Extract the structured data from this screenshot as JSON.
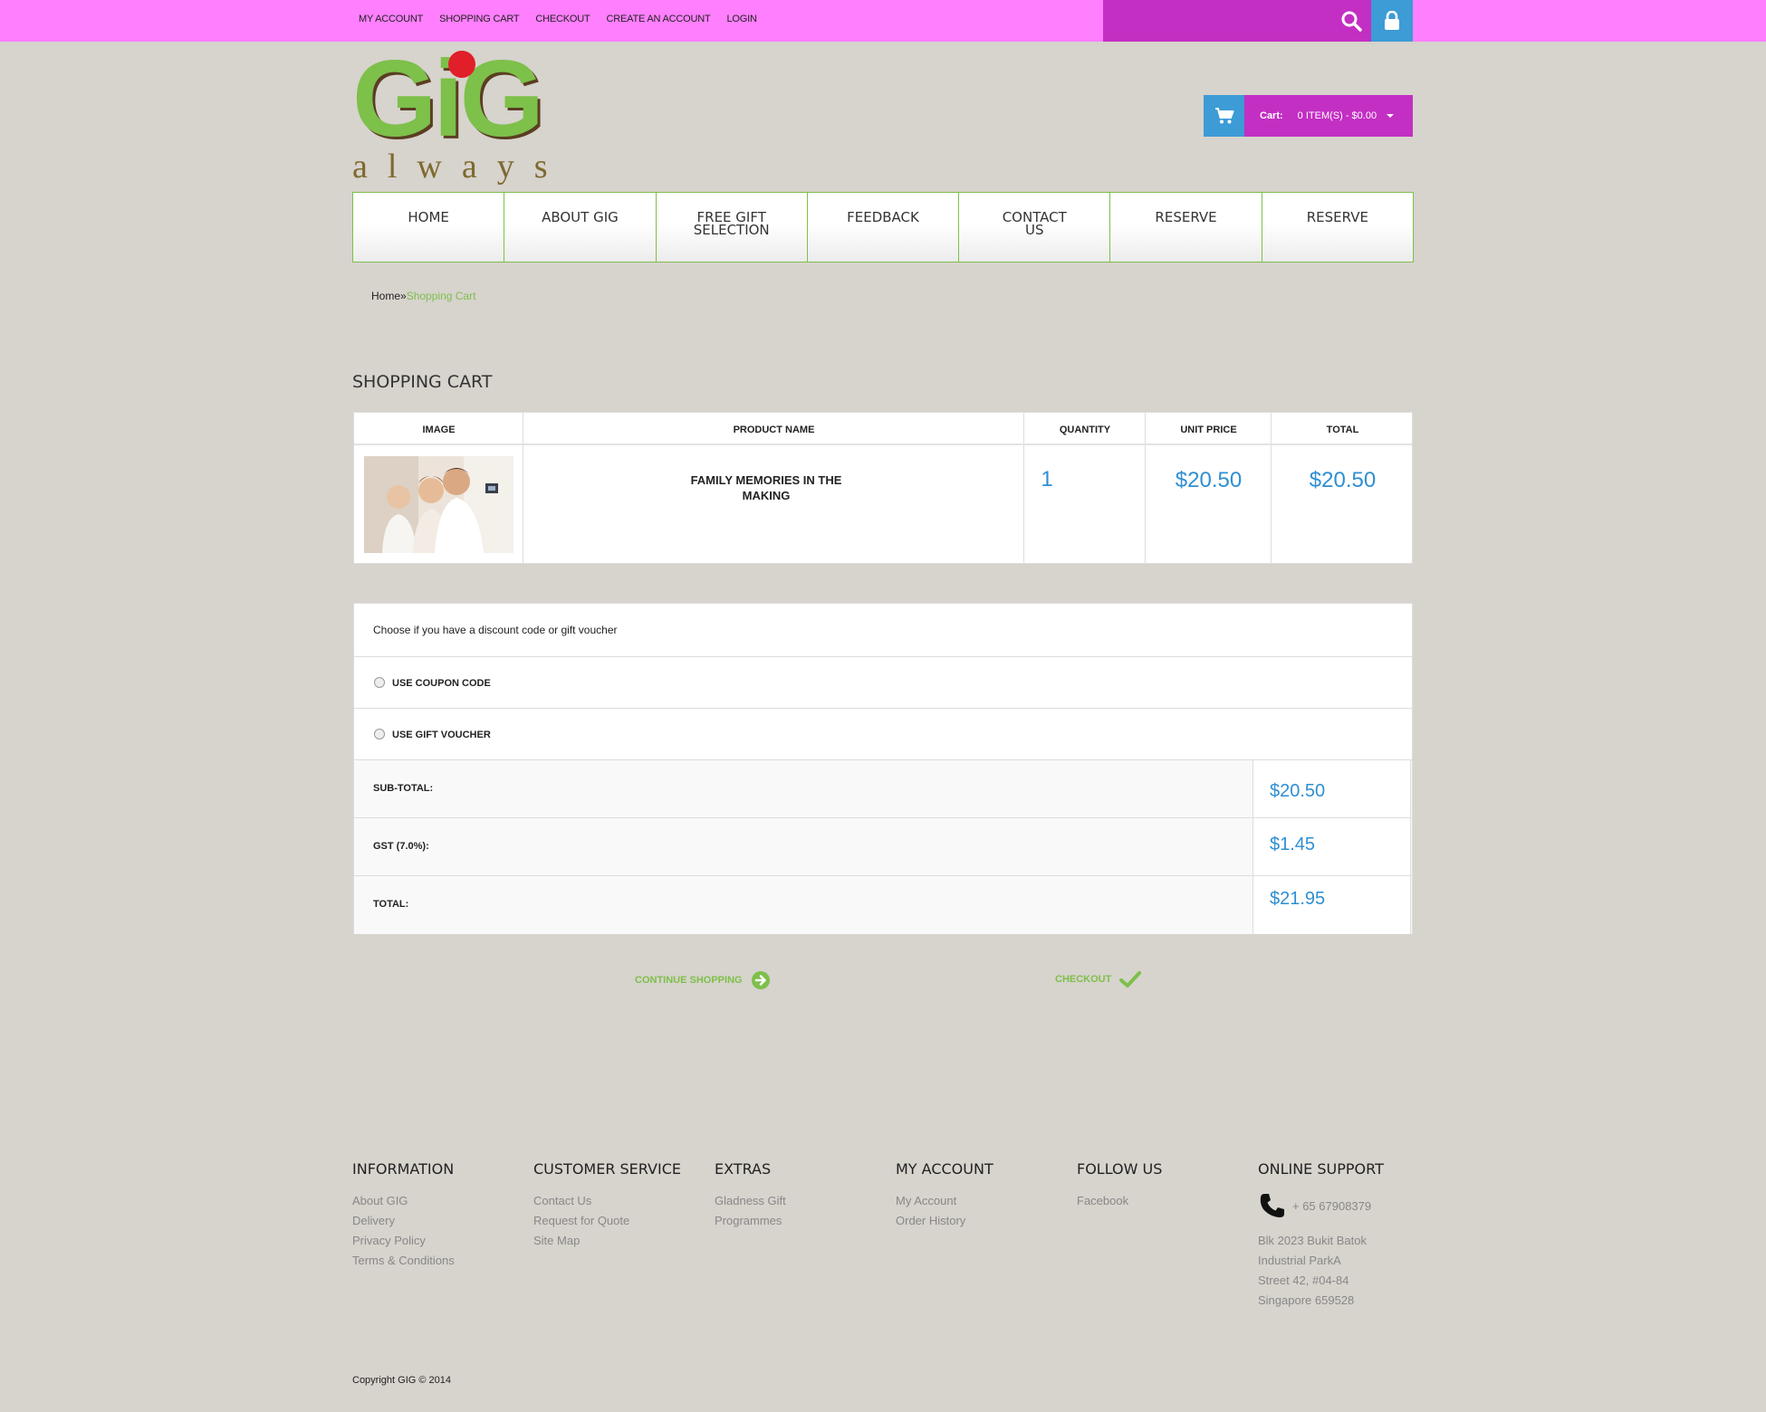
{
  "topbar": {
    "links": [
      "MY ACCOUNT",
      "SHOPPING CART",
      "CHECKOUT",
      "CREATE AN ACCOUNT",
      "LOGIN"
    ]
  },
  "logo": {
    "main": "GiG",
    "sub": "always"
  },
  "cart": {
    "label": "Cart:",
    "value": "0 ITEM(S) - $0.00"
  },
  "nav": [
    "HOME",
    "ABOUT GIG",
    "FREE GIFT SELECTION",
    "FEEDBACK",
    "CONTACT US",
    "RESERVE",
    "RESERVE"
  ],
  "breadcrumb": {
    "home": "Home",
    "separator": "»",
    "current": "Shopping Cart"
  },
  "page_title": "SHOPPING CART",
  "cart_table": {
    "headers": [
      "IMAGE",
      "PRODUCT NAME",
      "QUANTITY",
      "UNIT PRICE",
      "TOTAL"
    ],
    "rows": [
      {
        "product": "FAMILY MEMORIES IN THE MAKING",
        "quantity": "1",
        "unit_price": "$20.50",
        "total": "$20.50"
      }
    ]
  },
  "discount": {
    "prompt": "Choose if you have a discount code or gift voucher",
    "options": [
      "USE COUPON CODE",
      "USE GIFT VOUCHER"
    ]
  },
  "totals": [
    {
      "label": "SUB-TOTAL:",
      "value": "$20.50"
    },
    {
      "label": "GST (7.0%):",
      "value": "$1.45"
    },
    {
      "label": "TOTAL:",
      "value": "$21.95"
    }
  ],
  "actions": {
    "continue": "CONTINUE SHOPPING",
    "checkout": "CHECKOUT"
  },
  "footer": {
    "information": {
      "title": "INFORMATION",
      "links": [
        "About GIG",
        "Delivery",
        "Privacy Policy",
        "Terms & Conditions"
      ]
    },
    "customer_service": {
      "title": "CUSTOMER SERVICE",
      "links": [
        "Contact Us",
        "Request for Quote",
        "Site Map"
      ]
    },
    "extras": {
      "title": "EXTRAS",
      "links": [
        "Gladness Gift",
        "Programmes"
      ]
    },
    "my_account": {
      "title": "MY ACCOUNT",
      "links": [
        "My Account",
        "Order History"
      ]
    },
    "follow_us": {
      "title": "FOLLOW US",
      "links": [
        "Facebook"
      ]
    },
    "online_support": {
      "title": "ONLINE SUPPORT",
      "phone": "+ 65 67908379",
      "address": [
        "Blk 2023 Bukit Batok",
        "Industrial ParkA",
        "Street 42, #04-84",
        "Singapore 659528"
      ]
    }
  },
  "copyright": "Copyright GIG © 2014",
  "colors": {
    "topbar": "#ff7ffe",
    "accent_purple": "#c32fc3",
    "accent_blue": "#3d9bd6",
    "accent_green": "#7dc04a",
    "price_blue": "#2f8fd1"
  }
}
